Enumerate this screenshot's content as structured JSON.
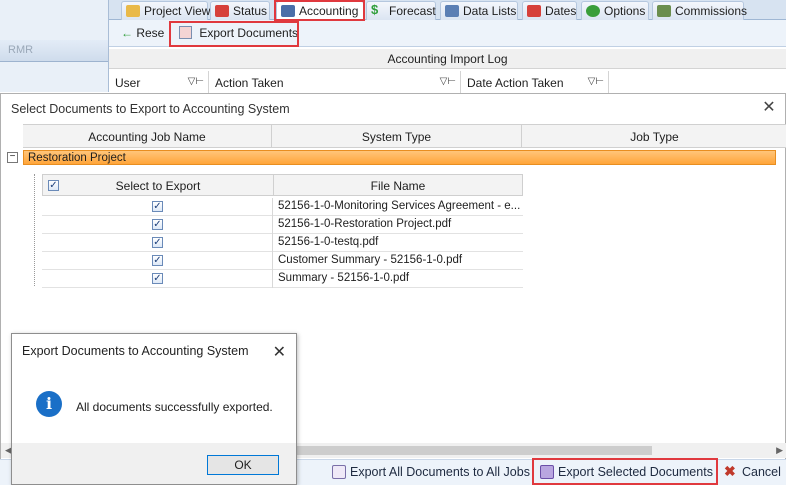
{
  "left_panel": {
    "tab_label": "RMR"
  },
  "tabs": [
    {
      "label": "Project View",
      "icon": "folder-icon",
      "color": "#e9b949"
    },
    {
      "label": "Status",
      "icon": "calendar-icon",
      "color": "#d6403a"
    },
    {
      "label": "Accounting",
      "icon": "ledger-icon",
      "color": "#4a6ea8"
    },
    {
      "label": "Forecast",
      "icon": "dollar-icon",
      "color": "#2f9e3a"
    },
    {
      "label": "Data Lists",
      "icon": "list-icon",
      "color": "#5b7fb4"
    },
    {
      "label": "Dates",
      "icon": "calendar-icon",
      "color": "#d6403a"
    },
    {
      "label": "Options",
      "icon": "check-circle-icon",
      "color": "#3a9e3a"
    },
    {
      "label": "Commissions",
      "icon": "people-icon",
      "color": "#6b8e4e"
    }
  ],
  "toolbar": {
    "reset_label": "Rese",
    "export_label": "Export Documents"
  },
  "log": {
    "title": "Accounting Import Log",
    "columns": [
      "User",
      "Action Taken",
      "Date Action Taken"
    ]
  },
  "dialog": {
    "title": "Select Documents to Export to Accounting System",
    "columns": [
      "Accounting Job Name",
      "System Type",
      "Job Type"
    ],
    "group_label": "Restoration Project",
    "inner_columns": [
      "Select to Export",
      "File Name"
    ],
    "files": [
      {
        "name": "52156-1-0-Monitoring Services Agreement - e...",
        "checked": true
      },
      {
        "name": "52156-1-0-Restoration Project.pdf",
        "checked": true
      },
      {
        "name": "52156-1-0-testq.pdf",
        "checked": true
      },
      {
        "name": "Customer Summary - 52156-1-0.pdf",
        "checked": true
      },
      {
        "name": "Summary - 52156-1-0.pdf",
        "checked": true
      }
    ]
  },
  "footer": {
    "export_all_label": "Export All Documents to All Jobs",
    "export_selected_label": "Export Selected Documents",
    "cancel_label": "Cancel"
  },
  "message": {
    "title": "Export Documents to Accounting System",
    "text": "All documents successfully exported.",
    "ok_label": "OK"
  },
  "colors": {
    "highlight": "#e0393e",
    "group_row": "#ffa53a",
    "info": "#1a6fc7"
  }
}
